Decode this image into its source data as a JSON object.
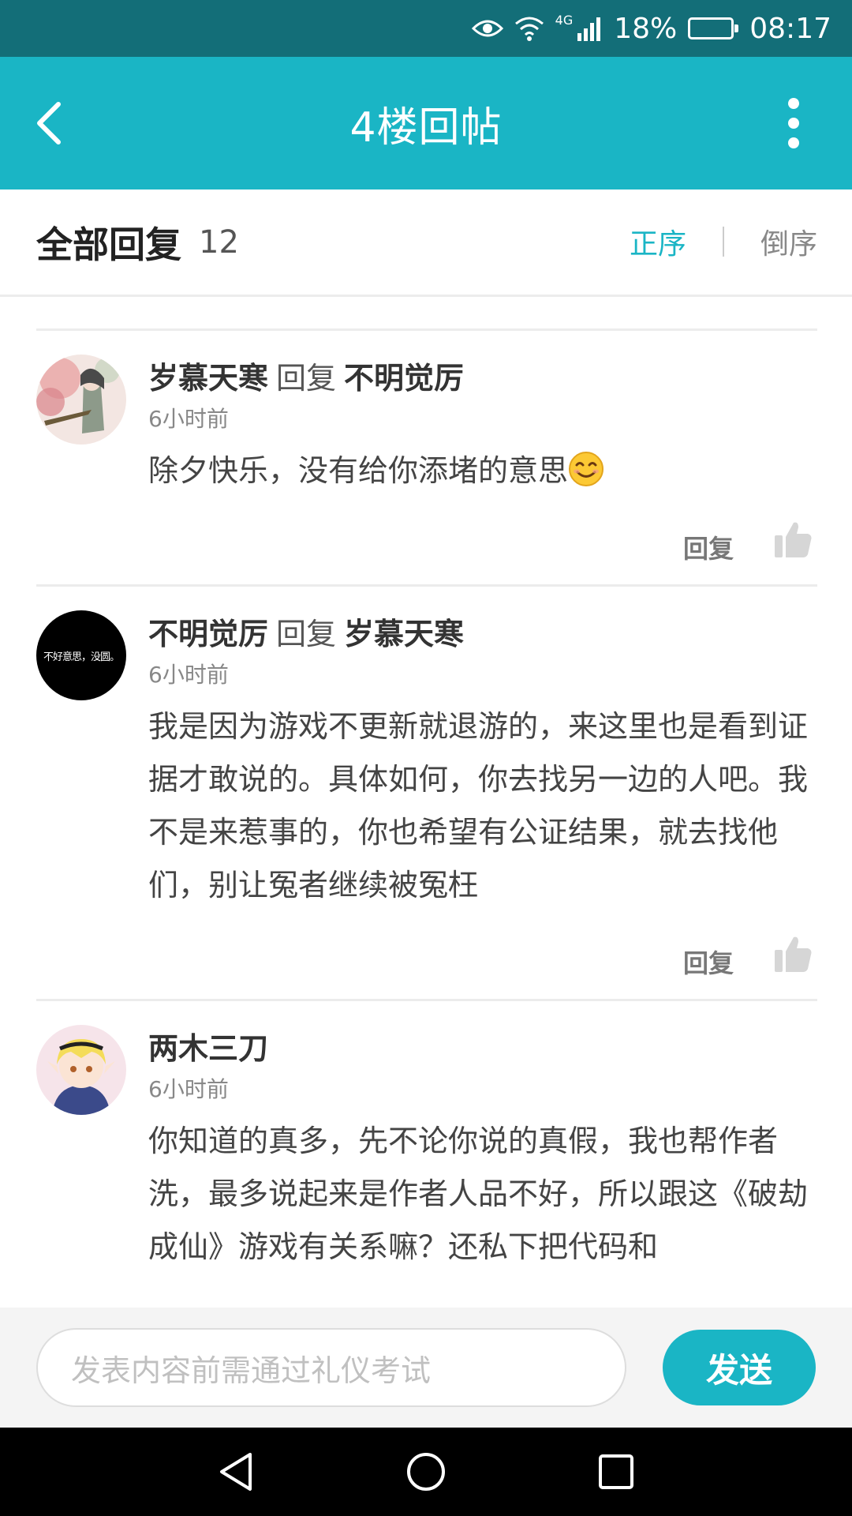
{
  "status_bar": {
    "network": "4G",
    "battery_percent": "18%",
    "battery_level": 0.18,
    "time": "08:17"
  },
  "header": {
    "title": "4楼回帖"
  },
  "sub_header": {
    "all_replies_label": "全部回复",
    "reply_count": "12",
    "sort_asc": "正序",
    "sort_desc": "倒序"
  },
  "comments": [
    {
      "username": "岁慕天寒",
      "reply_word": "回复",
      "reply_to": "不明觉厉",
      "time": "6小时前",
      "text": "除夕快乐，没有给你添堵的意思",
      "emoji": "smiling-face-icon",
      "reply_label": "回复"
    },
    {
      "username": "不明觉厉",
      "reply_word": "回复",
      "reply_to": "岁慕天寒",
      "avatar_text": "不好意思，没圆。",
      "time": "6小时前",
      "text": "我是因为游戏不更新就退游的，来这里也是看到证据才敢说的。具体如何，你去找另一边的人吧。我不是来惹事的，你也希望有公证结果，就去找他们，别让冤者继续被冤枉",
      "reply_label": "回复"
    },
    {
      "username": "两木三刀",
      "time": "6小时前",
      "text": "你知道的真多，先不论你说的真假，我也帮作者洗，最多说起来是作者人品不好，所以跟这《破劫成仙》游戏有关系嘛？还私下把代码和"
    }
  ],
  "input_bar": {
    "placeholder": "发表内容前需通过礼仪考试",
    "send_label": "发送"
  },
  "colors": {
    "accent": "#1ab5c5",
    "status_bar": "#136e78"
  }
}
